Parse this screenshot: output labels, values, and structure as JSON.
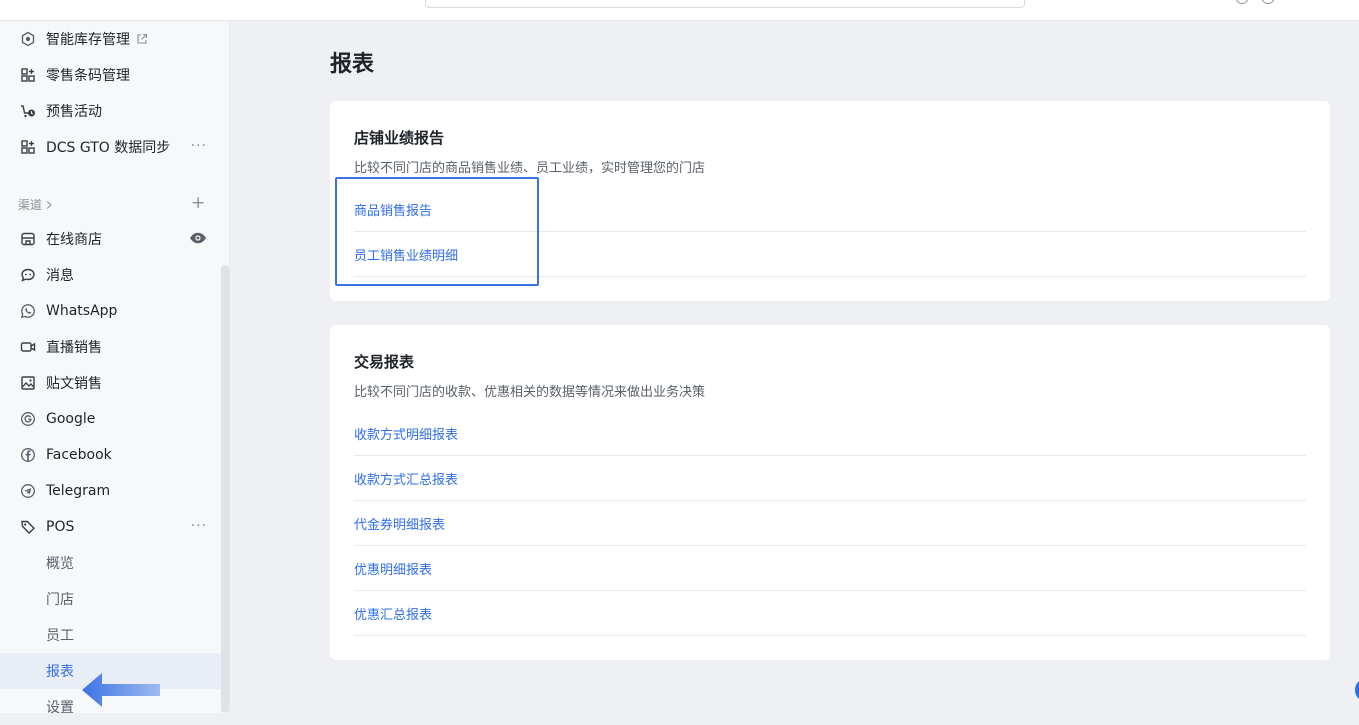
{
  "sidebar": {
    "items": [
      {
        "label": "智能库存管理",
        "icon": "hexagon-cube-icon",
        "external": true
      },
      {
        "label": "零售条码管理",
        "icon": "apps-grid-icon"
      },
      {
        "label": "预售活动",
        "icon": "cart-clock-icon"
      },
      {
        "label": "DCS GTO 数据同步",
        "icon": "apps-grid-icon",
        "more": "···"
      }
    ],
    "channels_label": "渠道",
    "channels_add": "+",
    "channels": [
      {
        "label": "在线商店",
        "icon": "storefront-icon",
        "eye": true
      },
      {
        "label": "消息",
        "icon": "chat-bubble-icon"
      },
      {
        "label": "WhatsApp",
        "icon": "whatsapp-icon"
      },
      {
        "label": "直播销售",
        "icon": "video-camera-icon"
      },
      {
        "label": "贴文销售",
        "icon": "image-post-icon"
      },
      {
        "label": "Google",
        "icon": "google-icon"
      },
      {
        "label": "Facebook",
        "icon": "facebook-icon"
      },
      {
        "label": "Telegram",
        "icon": "telegram-icon"
      },
      {
        "label": "POS",
        "icon": "price-tag-icon",
        "more": "···"
      }
    ],
    "pos_sub": [
      {
        "label": "概览"
      },
      {
        "label": "门店"
      },
      {
        "label": "员工"
      },
      {
        "label": "报表",
        "active": true
      },
      {
        "label": "设置"
      }
    ]
  },
  "main": {
    "title": "报表",
    "store_card": {
      "title": "店铺业绩报告",
      "description": "比较不同门店的商品销售业绩、员工业绩，实时管理您的门店",
      "links": [
        "商品销售报告",
        "员工销售业绩明细"
      ]
    },
    "transaction_card": {
      "title": "交易报表",
      "description": "比较不同门店的收款、优惠相关的数据等情况来做出业务决策",
      "links": [
        "收款方式明细报表",
        "收款方式汇总报表",
        "代金券明细报表",
        "优惠明细报表",
        "优惠汇总报表"
      ]
    }
  },
  "colors": {
    "accent": "#2f6ee8",
    "annotation": "#3b73e4",
    "sidebar_bg": "#f7f8fa",
    "page_bg": "#eef0f4"
  }
}
